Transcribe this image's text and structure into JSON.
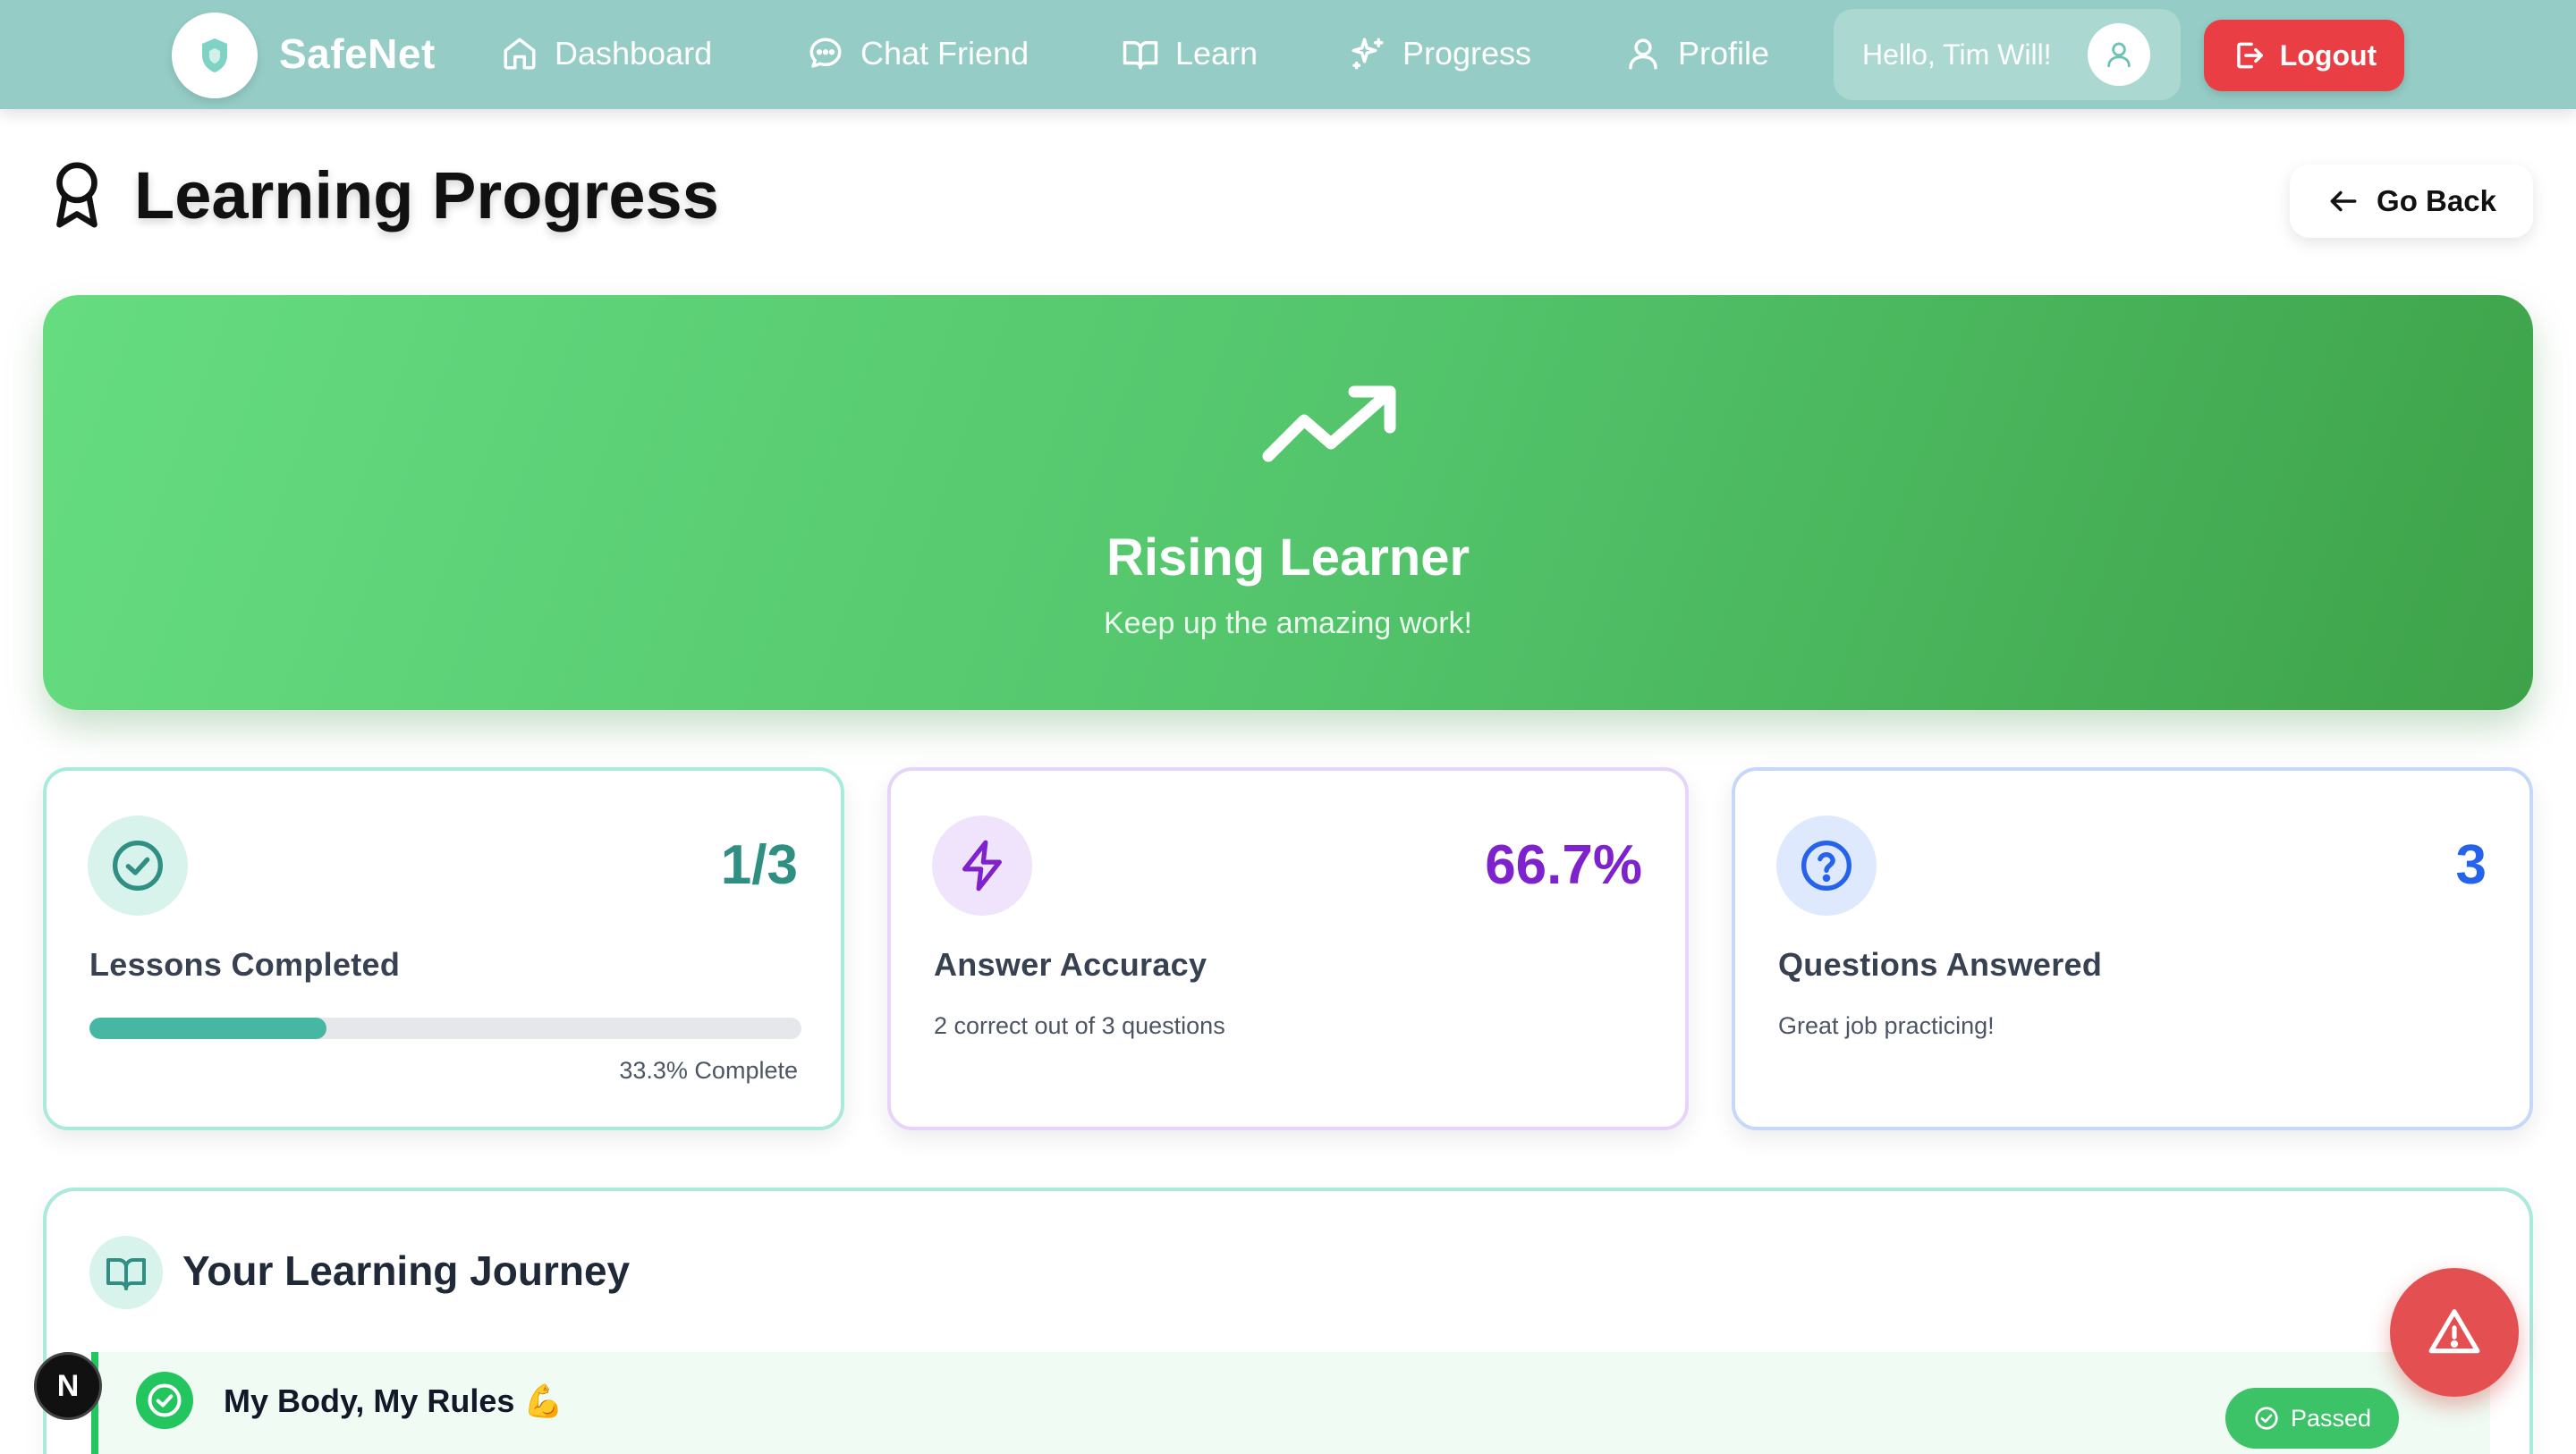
{
  "nav": {
    "brand": "SafeNet",
    "items": [
      {
        "label": "Dashboard",
        "icon": "home-icon"
      },
      {
        "label": "Chat Friend",
        "icon": "chat-bubble-icon"
      },
      {
        "label": "Learn",
        "icon": "book-icon"
      },
      {
        "label": "Progress",
        "icon": "sparkles-icon"
      },
      {
        "label": "Profile",
        "icon": "user-icon"
      }
    ],
    "greeting": "Hello, Tim Will!",
    "logout_label": "Logout"
  },
  "header": {
    "title": "Learning Progress",
    "title_icon": "award-ribbon-icon",
    "go_back_label": "Go Back"
  },
  "hero": {
    "icon": "trending-up-icon",
    "title": "Rising Learner",
    "subtitle": "Keep up the amazing work!"
  },
  "stats": {
    "lessons": {
      "value": "1/3",
      "label": "Lessons Completed",
      "progress": 0.333,
      "progress_text": "33.3% Complete",
      "color": "#2f8f83"
    },
    "accuracy": {
      "value": "66.7%",
      "label": "Answer Accuracy",
      "desc": "2 correct out of 3 questions",
      "color": "#7e22ce"
    },
    "questions": {
      "value": "3",
      "label": "Questions Answered",
      "desc": "Great job practicing!",
      "color": "#2563eb"
    }
  },
  "journey": {
    "title": "Your Learning Journey",
    "lessons": [
      {
        "title": "My Body, My Rules 💪",
        "status": "Passed"
      }
    ]
  },
  "floating": {
    "sos_icon": "warning-triangle-icon",
    "badge_letter": "N"
  }
}
